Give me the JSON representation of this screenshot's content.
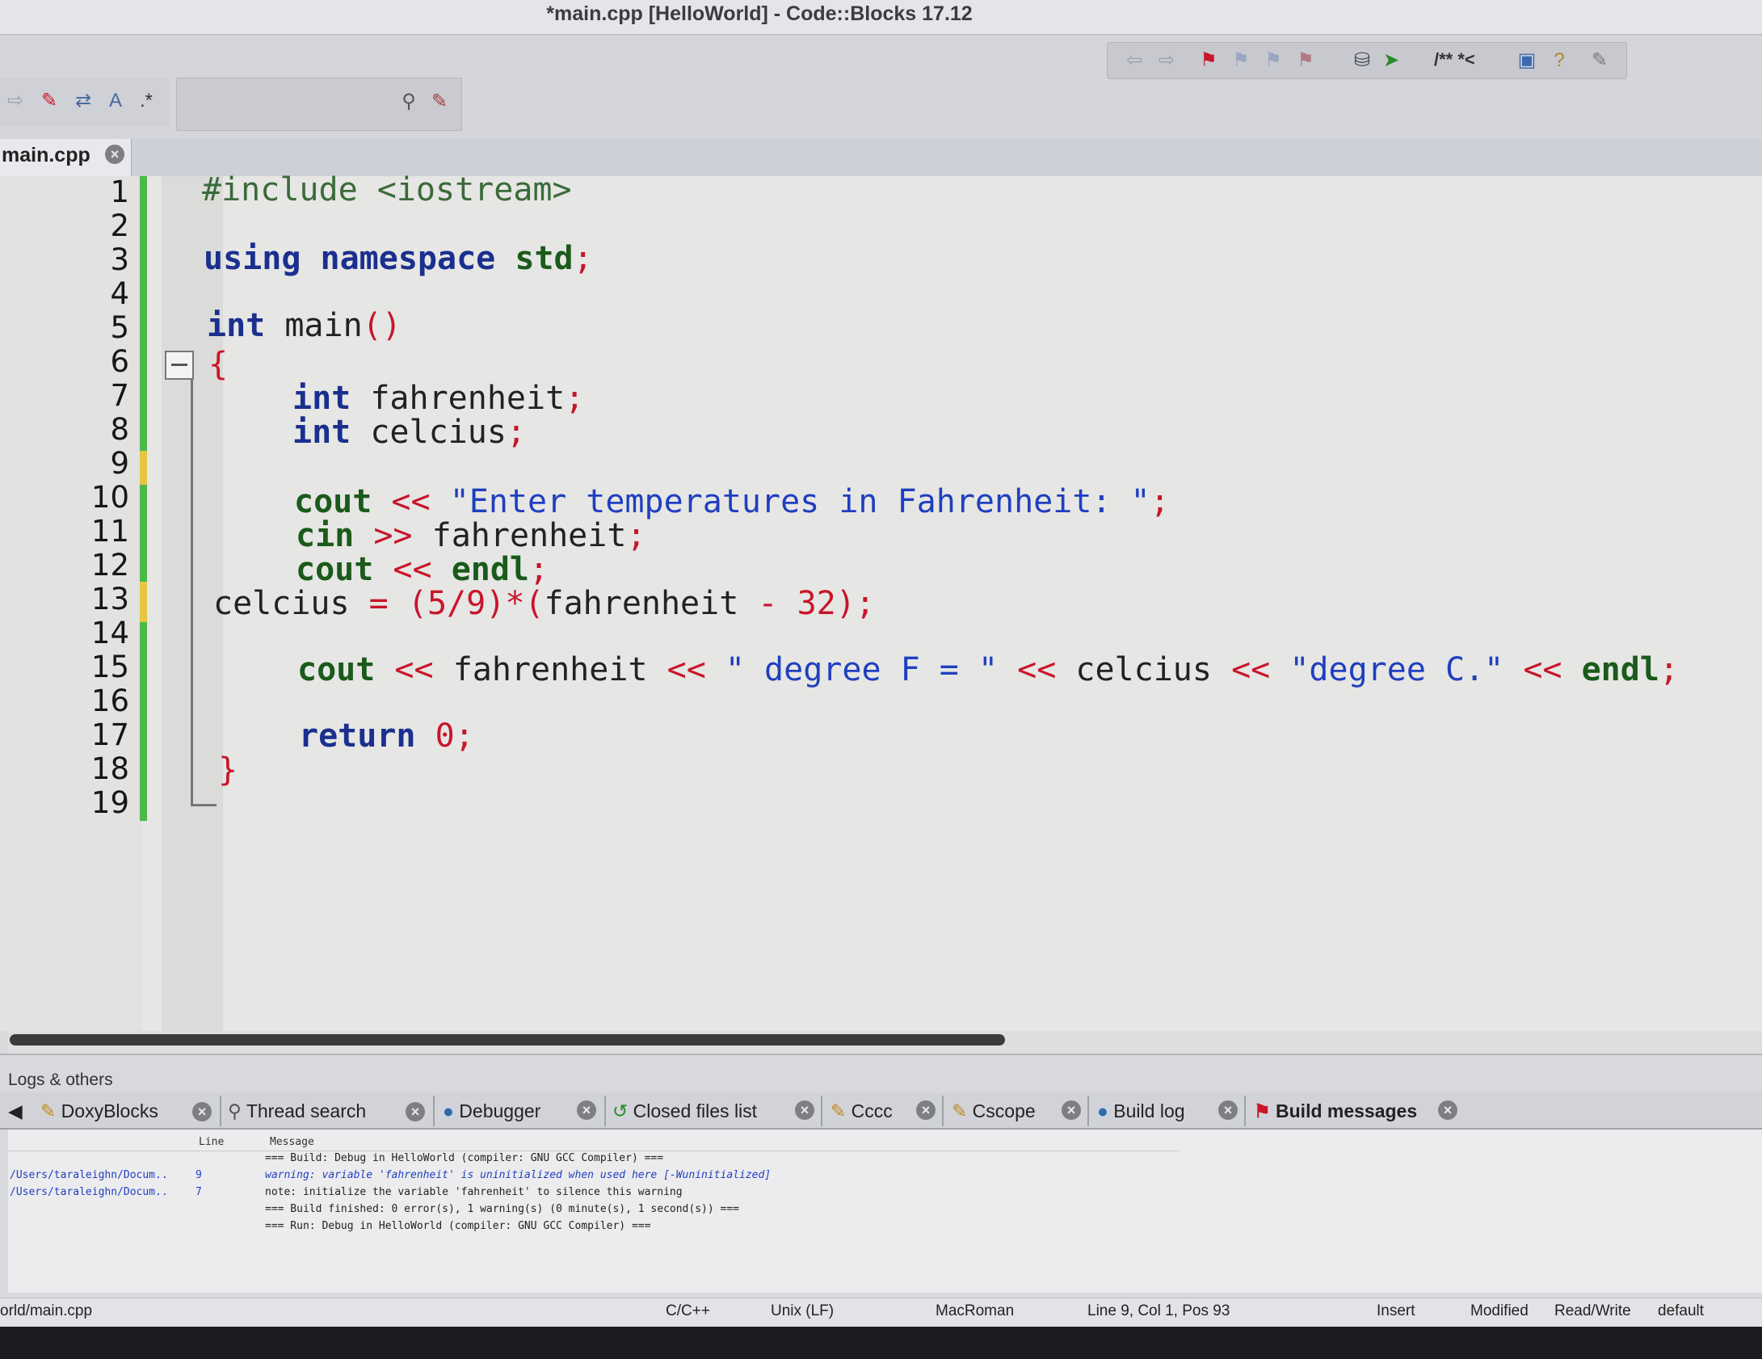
{
  "window": {
    "title": "*main.cpp [HelloWorld] - Code::Blocks 17.12"
  },
  "editor": {
    "tab_label": "main.cpp",
    "line_numbers": [
      "1",
      "2",
      "3",
      "4",
      "5",
      "6",
      "7",
      "8",
      "9",
      "10",
      "11",
      "12",
      "13",
      "14",
      "15",
      "16",
      "17",
      "18",
      "19"
    ],
    "code": {
      "l1_include": "#include <iostream>",
      "l3_using": "using",
      "l3_namespace": "namespace",
      "l3_std": "std",
      "l5_int": "int",
      "l5_main": "main",
      "l6_brace": "{",
      "l7_int": "int",
      "l7_var": "fahrenheit",
      "l8_int": "int",
      "l8_var": "celcius",
      "l10_cout": "cout",
      "l10_str": "\"Enter temperatures in Fahrenheit: \"",
      "l11_cin": "cin",
      "l11_var": "fahrenheit",
      "l12_cout": "cout",
      "l12_endl": "endl",
      "l13_var": "celcius",
      "l13_five": "5",
      "l13_nine": "9",
      "l13_fahr": "fahrenheit",
      "l13_num": "32",
      "l15_cout": "cout",
      "l15_fahr": "fahrenheit",
      "l15_str1": "\" degree F = \"",
      "l15_cel": "celcius",
      "l15_str2": "\"degree C.\"",
      "l15_endl": "endl",
      "l17_return": "return",
      "l17_zero": "0",
      "l18_brace": "}"
    }
  },
  "logs": {
    "panel_title": "Logs & others",
    "tabs": [
      "DoxyBlocks",
      "Thread search",
      "Debugger",
      "Closed files list",
      "Cccc",
      "Cscope",
      "Build log",
      "Build messages"
    ],
    "active_tab": "Build messages",
    "columns": {
      "line": "Line",
      "message": "Message"
    },
    "rows": [
      {
        "file": "",
        "line": "",
        "message": "=== Build: Debug in HelloWorld (compiler: GNU GCC Compiler) ==="
      },
      {
        "file": "/Users/taraleighn/Docum..",
        "line": "9",
        "message": "warning: variable 'fahrenheit' is uninitialized when used here [-Wuninitialized]"
      },
      {
        "file": "/Users/taraleighn/Docum..",
        "line": "7",
        "message": "note: initialize the variable 'fahrenheit' to silence this warning"
      },
      {
        "file": "",
        "line": "",
        "message": "=== Build finished: 0 error(s), 1 warning(s) (0 minute(s), 1 second(s)) ==="
      },
      {
        "file": "",
        "line": "",
        "message": "=== Run: Debug in HelloWorld (compiler: GNU GCC Compiler) ==="
      }
    ]
  },
  "statusbar": {
    "path": "orld/main.cpp",
    "language": "C/C++",
    "line_endings": "Unix (LF)",
    "encoding": "MacRoman",
    "position": "Line 9, Col 1, Pos 93",
    "insert_mode": "Insert",
    "modified": "Modified",
    "access": "Read/Write",
    "profile": "default"
  },
  "toolbar": {
    "bookmark_icons": [
      "arrow-left-icon",
      "arrow-right-icon",
      "flag-icon",
      "flag-prev-icon",
      "flag-next-icon",
      "flag-clear-icon"
    ],
    "doc_comment_label": "/** *<"
  },
  "colors": {
    "change_bar": "#4bb94a",
    "change_bar_modified": "#e4c642",
    "keyword": "#1a2f8e",
    "string": "#1f3fc0",
    "operator": "#c8152a"
  }
}
